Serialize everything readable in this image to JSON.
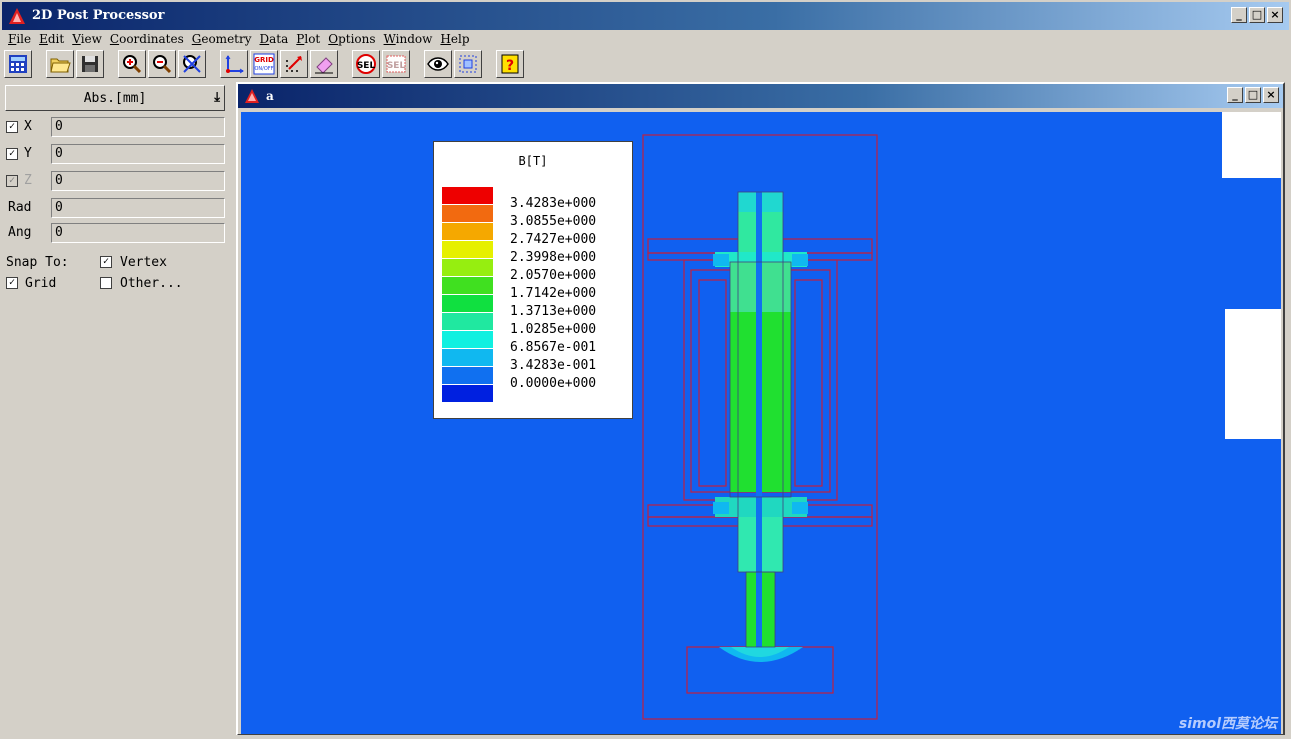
{
  "window": {
    "title": "2D Post Processor",
    "controls": [
      "_",
      "□",
      "×"
    ]
  },
  "menu": [
    {
      "label": "File",
      "key": "F",
      "rest": "ile"
    },
    {
      "label": "Edit",
      "key": "E",
      "rest": "dit"
    },
    {
      "label": "View",
      "key": "V",
      "rest": "iew"
    },
    {
      "label": "Coordinates",
      "key": "C",
      "rest": "oordinates"
    },
    {
      "label": "Geometry",
      "key": "G",
      "rest": "eometry"
    },
    {
      "label": "Data",
      "key": "D",
      "rest": "ata"
    },
    {
      "label": "Plot",
      "key": "P",
      "rest": "lot"
    },
    {
      "label": "Options",
      "key": "O",
      "rest": "ptions"
    },
    {
      "label": "Window",
      "key": "W",
      "rest": "indow"
    },
    {
      "label": "Help",
      "key": "H",
      "rest": "elp"
    }
  ],
  "toolbar": {
    "buttons": [
      {
        "name": "calculator-icon"
      },
      {
        "name": "open-folder-icon"
      },
      {
        "name": "save-disk-icon"
      },
      {
        "name": "zoom-in-icon"
      },
      {
        "name": "zoom-out-icon"
      },
      {
        "name": "zoom-extents-icon"
      },
      {
        "name": "coordinate-axes-icon"
      },
      {
        "name": "grid-toggle-icon",
        "text": "GRID ON/OFF"
      },
      {
        "name": "snap-point-icon"
      },
      {
        "name": "eraser-icon"
      },
      {
        "name": "select-icon",
        "text": "SEL"
      },
      {
        "name": "unselect-icon",
        "text": "SEL"
      },
      {
        "name": "eye-view-icon"
      },
      {
        "name": "refresh-view-icon"
      },
      {
        "name": "help-icon",
        "text": "?"
      }
    ]
  },
  "coords_panel": {
    "mode": "Abs.[mm]",
    "fields": [
      {
        "label": "X",
        "value": "0",
        "checked": true,
        "enabled": true
      },
      {
        "label": "Y",
        "value": "0",
        "checked": true,
        "enabled": true
      },
      {
        "label": "Z",
        "value": "0",
        "checked": true,
        "enabled": false
      },
      {
        "label": "Rad",
        "value": "0"
      },
      {
        "label": "Ang",
        "value": "0"
      }
    ],
    "snap_to": "Snap To:",
    "vertex": "Vertex",
    "grid": "Grid",
    "other": "Other..."
  },
  "child_window": {
    "title": "a"
  },
  "legend": {
    "title": "B[T]",
    "entries": [
      {
        "value": "3.4283e+000",
        "color": "#ee0000"
      },
      {
        "value": "3.0855e+000",
        "color": "#f26a10"
      },
      {
        "value": "2.7427e+000",
        "color": "#f5a800"
      },
      {
        "value": "2.3998e+000",
        "color": "#e6f000"
      },
      {
        "value": "2.0570e+000",
        "color": "#96ee10"
      },
      {
        "value": "1.7142e+000",
        "color": "#40e020"
      },
      {
        "value": "1.3713e+000",
        "color": "#10e040"
      },
      {
        "value": "1.0285e+000",
        "color": "#20e8a0"
      },
      {
        "value": "6.8567e-001",
        "color": "#10f0e0"
      },
      {
        "value": "3.4283e-001",
        "color": "#10b8f0"
      },
      {
        "value": "0.0000e+000",
        "color": "#1070f0"
      },
      {
        "value": "",
        "color": "#0020e0"
      }
    ]
  },
  "watermark": "simol西莫论坛",
  "colors": {
    "background_field": "#1060f0",
    "outline": "#c02040",
    "core_green": "#20e030",
    "cyan": "#20e8c8"
  }
}
